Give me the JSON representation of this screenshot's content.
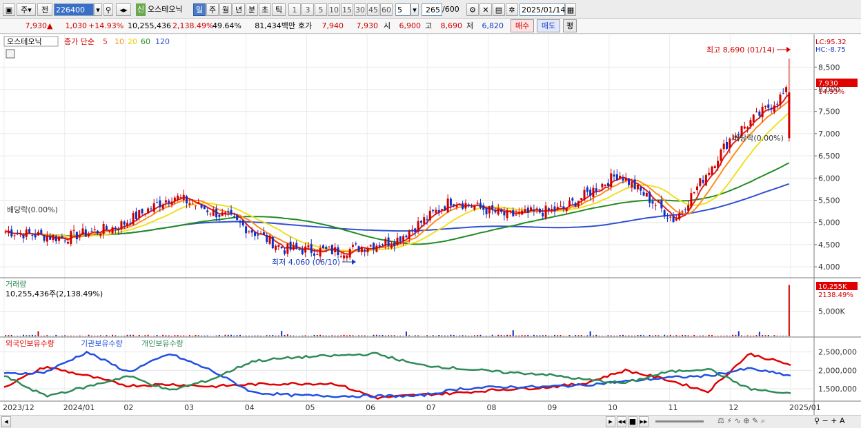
{
  "toolbar": {
    "market": "주",
    "prev": "전",
    "code": "226400",
    "new_badge": "신",
    "stock_name": "오스테오닉",
    "periods": [
      "일",
      "주",
      "월",
      "년",
      "분",
      "초",
      "틱"
    ],
    "active_period": "일",
    "intervals": [
      "1",
      "3",
      "5",
      "10",
      "15",
      "30",
      "45",
      "60"
    ],
    "interval_select": "5",
    "count": "265",
    "count_max": "/600",
    "date": "2025/01/14"
  },
  "quote": {
    "price": "7,930",
    "arrow": "▲",
    "change": "1,030",
    "change_pct": "+14.93%",
    "volume": "10,255,436",
    "volume_pct": "2,138.49%",
    "turnover": "49.64%",
    "amount": "81,434백만",
    "hoga_label": "호가",
    "ask": "7,940",
    "bid": "7,930",
    "open_label": "시",
    "open": "6,900",
    "high_label": "고",
    "high": "8,690",
    "low_label": "저",
    "low": "6,820",
    "buy_btn": "매수",
    "sell_btn": "매도",
    "eval_btn": "평"
  },
  "price_panel": {
    "name_tag": "오스테오닉",
    "ma_label": "종가 단순",
    "ma_periods": [
      "5",
      "10",
      "20",
      "60",
      "120"
    ],
    "lc": "LC:95.32",
    "hc": "HC:-8.75",
    "max_note": "최고 8,690 (01/14)",
    "min_note": "최저 4,060 (06/10)",
    "dividend_left": "배당락(0.00%)",
    "dividend_right": "배당락(0.00%)",
    "last_price_tag": "7,930",
    "last_pct_tag": "14.93%"
  },
  "volume_panel": {
    "title": "거래량",
    "summary": "10,255,436주(2,138.49%)",
    "last_tag": "10,255K",
    "last_pct": "2138.49%"
  },
  "holdings_panel": {
    "foreign": "외국인보유수량",
    "institution": "기관보유수량",
    "individual": "개인보유수량"
  },
  "colors": {
    "up": "#d00000",
    "down": "#1030c0",
    "ma5": "#e02020",
    "ma10": "#ff8c1a",
    "ma20": "#f0e020",
    "ma60": "#228b22",
    "ma120": "#3050d0",
    "foreign": "#e00000",
    "institution": "#2050e0",
    "individual": "#2e8b57"
  },
  "chart_data": [
    {
      "type": "candlestick",
      "title": "오스테오닉",
      "x": [
        "2023/12",
        "2024/01",
        "02",
        "03",
        "04",
        "05",
        "06",
        "07",
        "08",
        "09",
        "10",
        "11",
        "12",
        "2025/01"
      ],
      "ylim": [
        3800,
        8800
      ],
      "yticks": [
        4000,
        4500,
        5000,
        5500,
        6000,
        6500,
        7000,
        7500,
        8000,
        8500
      ],
      "close_monthly": [
        4800,
        4650,
        4900,
        5600,
        5100,
        4400,
        4350,
        4600,
        5500,
        5150,
        5300,
        6100,
        5050,
        6900,
        7930
      ],
      "high_point": {
        "label": "최고",
        "value": 8690,
        "date": "01/14"
      },
      "low_point": {
        "label": "최저",
        "value": 4060,
        "date": "06/10"
      },
      "last": {
        "open": 6900,
        "high": 8690,
        "low": 6820,
        "close": 7930
      },
      "series": [
        {
          "name": "5",
          "color": "#e02020"
        },
        {
          "name": "10",
          "color": "#ff8c1a"
        },
        {
          "name": "20",
          "color": "#f0e020"
        },
        {
          "name": "60",
          "color": "#228b22"
        },
        {
          "name": "120",
          "color": "#3050d0"
        }
      ]
    },
    {
      "type": "bar",
      "title": "거래량",
      "yticks_label": [
        "5,000K"
      ],
      "ylim": [
        0,
        11000000
      ],
      "last_value": 10255436
    },
    {
      "type": "line",
      "yticks": [
        1500000,
        2000000,
        2500000
      ],
      "yticks_label": [
        "1,500,000",
        "2,000,000",
        "2,500,000"
      ],
      "ylim": [
        1200000,
        2700000
      ],
      "series": [
        {
          "name": "외국인보유수량",
          "values": [
            1550000,
            2100000,
            1850000,
            1580000,
            1620000,
            1560000,
            1620000,
            1640000,
            1640000,
            1250000,
            1330000,
            1390000,
            1480000,
            1530000,
            1640000,
            2000000,
            1750000,
            1420000,
            2450000,
            2150000
          ]
        },
        {
          "name": "기관보유수량",
          "values": [
            1900000,
            1950000,
            2500000,
            1950000,
            2450000,
            2000000,
            1400000,
            1320000,
            1300000,
            1300000,
            1300000,
            1500000,
            1550000,
            1550000,
            1600000,
            1700000,
            1800000,
            1850000,
            2050000,
            1850000
          ]
        },
        {
          "name": "개인보유수량",
          "values": [
            1850000,
            1300000,
            1550000,
            1850000,
            1450000,
            1750000,
            2250000,
            2350000,
            2400000,
            2450000,
            2150000,
            2050000,
            1950000,
            1900000,
            1750000,
            1650000,
            1950000,
            2050000,
            1500000,
            1350000
          ]
        }
      ]
    }
  ]
}
